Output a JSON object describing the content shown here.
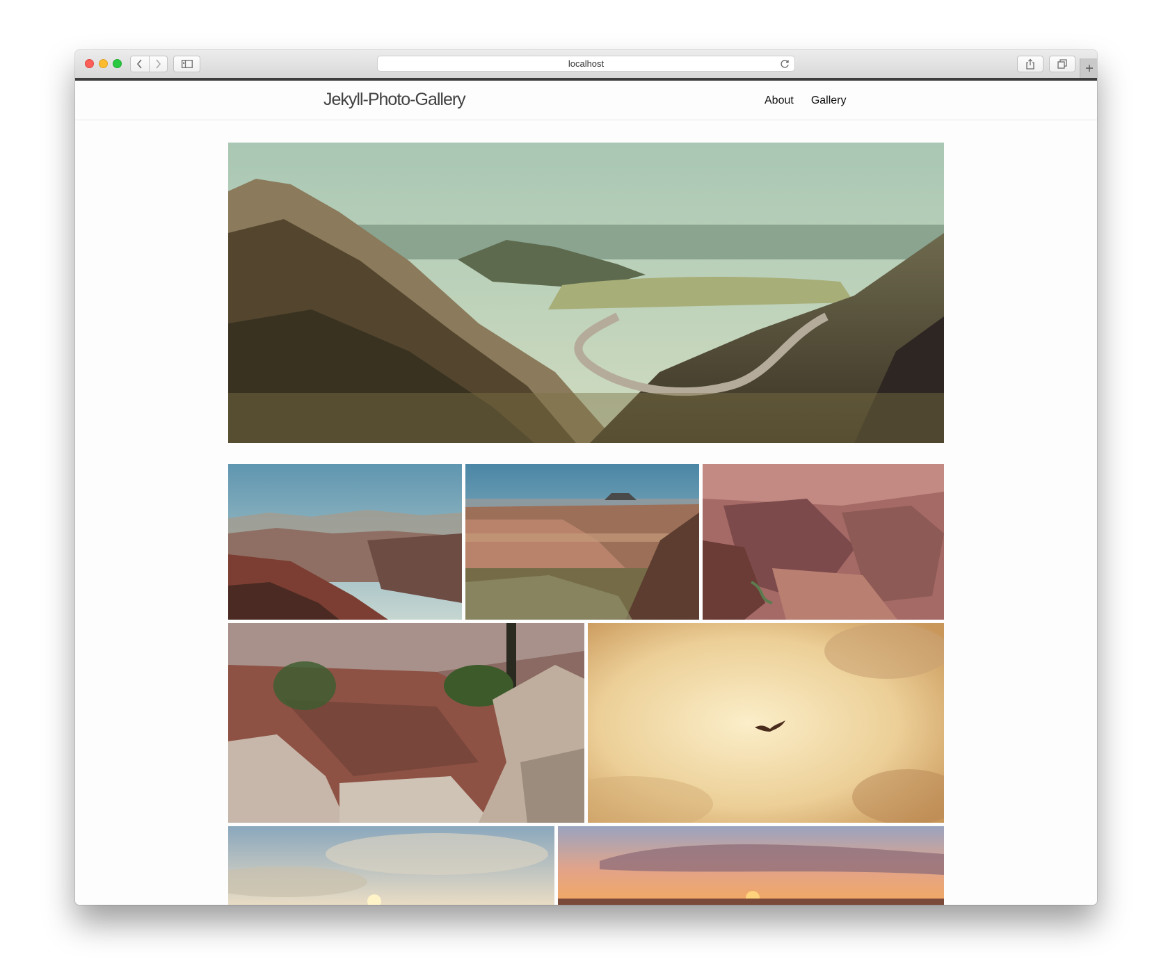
{
  "browser": {
    "url": "localhost",
    "icons": {
      "back": "chevron-left-icon",
      "forward": "chevron-right-icon",
      "sidebar": "sidebar-icon",
      "reload": "reload-icon",
      "share": "share-icon",
      "tabs": "tabs-icon",
      "new_tab": "plus-icon"
    }
  },
  "site": {
    "title": "Jekyll-Photo-Gallery",
    "nav": [
      {
        "label": "About"
      },
      {
        "label": "Gallery"
      }
    ]
  },
  "gallery": {
    "photos": [
      {
        "subject": "hero",
        "description": "winding road through forested desert hills"
      },
      {
        "subject": "1",
        "description": "hazy canyon vista"
      },
      {
        "subject": "2",
        "description": "canyon wall with flat-topped butte"
      },
      {
        "subject": "3",
        "description": "red canyon rock formations"
      },
      {
        "subject": "4",
        "description": "rocky canyon overlook with pine"
      },
      {
        "subject": "5",
        "description": "golden clouds with soaring bird"
      },
      {
        "subject": "6",
        "description": "sunset clouds over canyon rim"
      },
      {
        "subject": "7",
        "description": "orange sunset over horizon"
      }
    ]
  },
  "colors": {
    "page_bg": "#fdfdfd",
    "title_text": "#424242",
    "nav_text": "#111111",
    "loading_bar": "#3d3d3d"
  }
}
